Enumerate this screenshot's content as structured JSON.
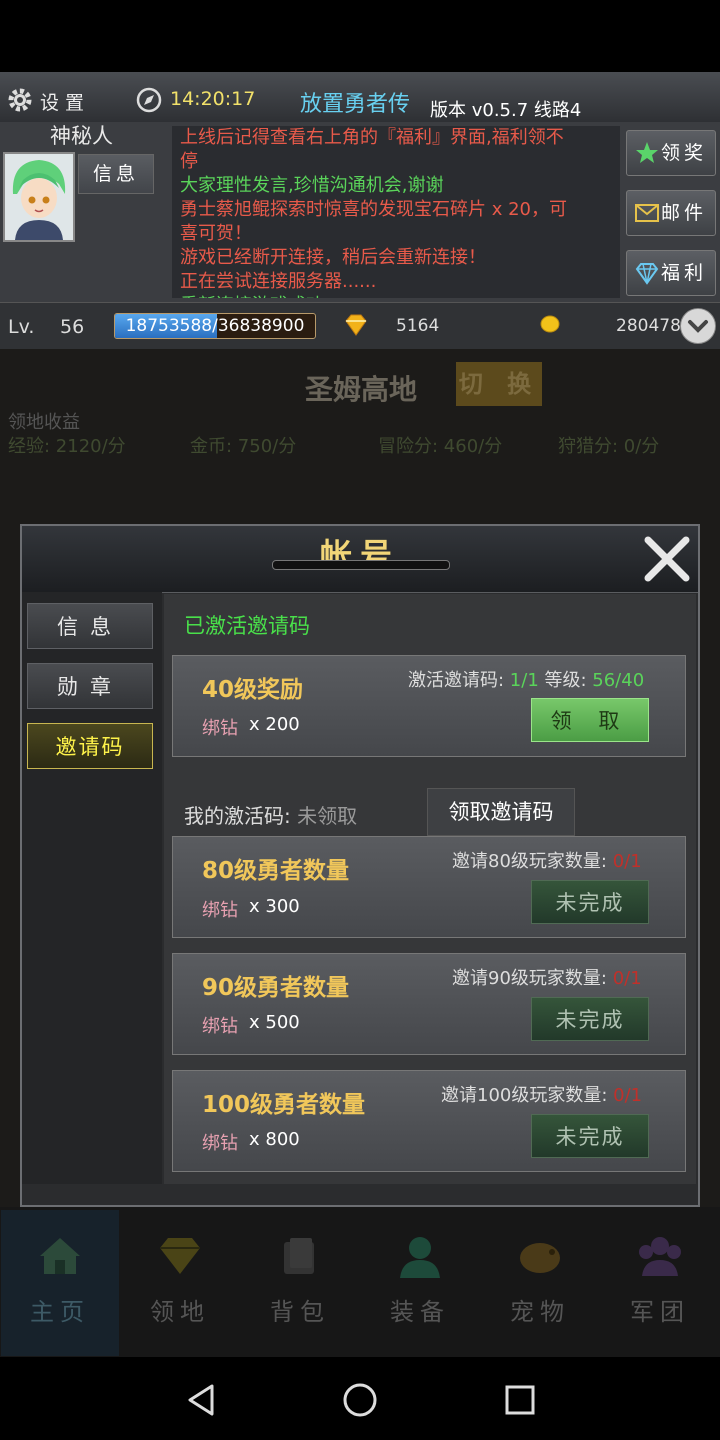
{
  "topbar": {
    "settings_label": "设 置",
    "time": "14:20:17",
    "game_title": "放置勇者传",
    "version": "版本 v0.5.7  线路4"
  },
  "profile": {
    "name": "神秘人",
    "info_button": "信息"
  },
  "chat": {
    "lines": [
      {
        "text": "上线后记得查看右上角的『福利』界面,福利领不",
        "color": "#e85a4a"
      },
      {
        "text": "停",
        "color": "#e85a4a"
      },
      {
        "text": "大家理性发言,珍惜沟通机会,谢谢",
        "color": "#5ad45a"
      },
      {
        "text": "勇士蔡旭鲲探索时惊喜的发现宝石碎片 x 20，可",
        "color": "#e85a4a"
      },
      {
        "text": "喜可贺！",
        "color": "#e85a4a"
      },
      {
        "text": "游戏已经断开连接，稍后会重新连接！",
        "color": "#e85a4a"
      },
      {
        "text": "正在尝试连接服务器......",
        "color": "#e85a4a"
      },
      {
        "text": "重新连接游戏成功!",
        "color": "#5ad45a"
      }
    ]
  },
  "side_buttons": {
    "reward": "领奖",
    "mail": "邮件",
    "welfare": "福利"
  },
  "stats": {
    "lv_label": "Lv.",
    "level": "56",
    "exp_current": "18753588",
    "exp_total": "/36838900",
    "exp_fraction": 0.509,
    "diamonds": "5164",
    "coins": "280478"
  },
  "background": {
    "region_title": "圣姆高地",
    "switch_button": "切 换",
    "income_label": "领地收益",
    "income": [
      "经验: 2120/分",
      "金币: 750/分",
      "冒险分: 460/分",
      "狩猎分: 0/分"
    ]
  },
  "modal": {
    "title": "帐号",
    "close_symbol": "✕",
    "nav": [
      "信息",
      "勋章",
      "邀请码"
    ],
    "activated_label": "已激活邀请码",
    "cards": [
      {
        "title": "40级奖励",
        "reward_label": "绑钻",
        "reward_value": "x 200",
        "req_label": "激活邀请码: ",
        "req_value": "1/1",
        "req_extra_label": " 等级: ",
        "req_extra_value": "56/40",
        "button": "领 取",
        "status": "claimable"
      },
      {
        "title": "80级勇者数量",
        "reward_label": "绑钻",
        "reward_value": "x 300",
        "req_label": "邀请80级玩家数量: ",
        "req_value": "0/1",
        "button": "未完成",
        "status": "incomplete"
      },
      {
        "title": "90级勇者数量",
        "reward_label": "绑钻",
        "reward_value": "x 500",
        "req_label": "邀请90级玩家数量: ",
        "req_value": "0/1",
        "button": "未完成",
        "status": "incomplete"
      },
      {
        "title": "100级勇者数量",
        "reward_label": "绑钻",
        "reward_value": "x 800",
        "req_label": "邀请100级玩家数量: ",
        "req_value": "0/1",
        "button": "未完成",
        "status": "incomplete"
      }
    ],
    "my_code_label": "我的激活码: ",
    "my_code_value": "未领取",
    "get_code_button": "领取邀请码"
  },
  "bottom_nav": [
    "主页",
    "领地",
    "背包",
    "装备",
    "宠物",
    "军团"
  ],
  "colors": {
    "accent_gold": "#f1c75a",
    "success_green": "#5ad45a",
    "alert_red": "#c0302a"
  }
}
